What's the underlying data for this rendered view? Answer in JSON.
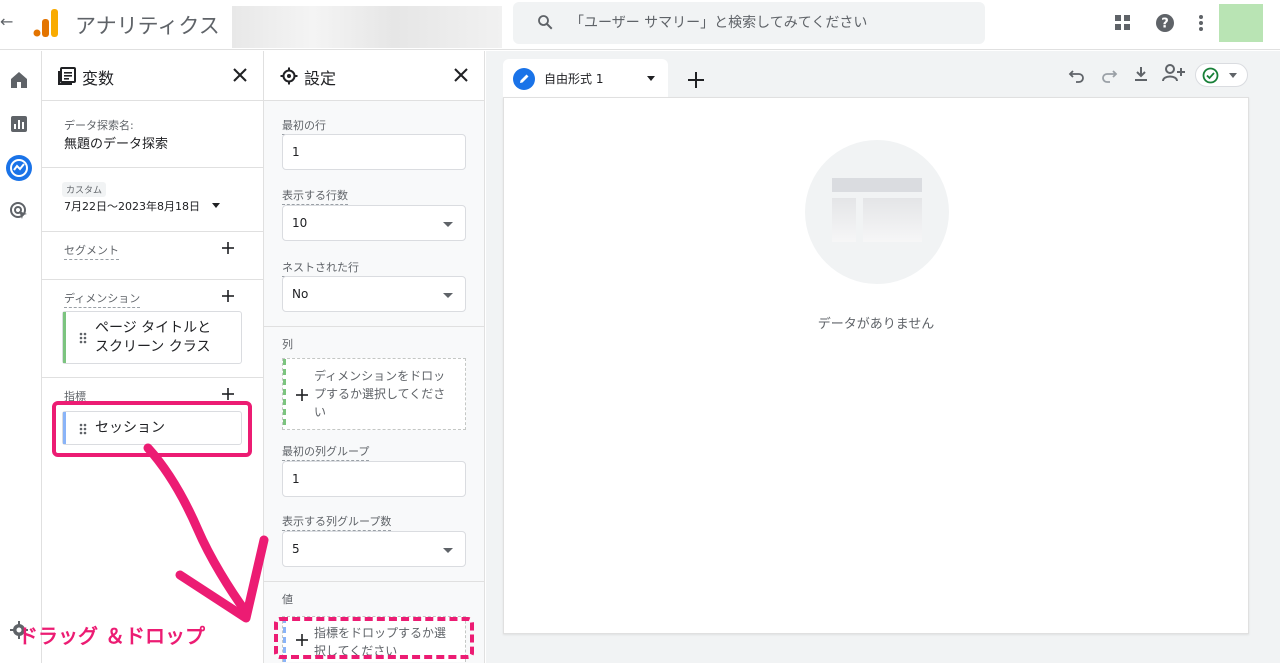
{
  "topbar": {
    "app_title": "アナリティクス",
    "search_placeholder": "「ユーザー サマリー」と検索してみてください"
  },
  "variables_panel": {
    "title": "変数",
    "exploration_name_label": "データ探索名:",
    "exploration_name": "無題のデータ探索",
    "date_badge": "カスタム",
    "date_range": "7月22日～2023年8月18日",
    "segment_label": "セグメント",
    "dimension_label": "ディメンション",
    "dimension_item_line1": "ページ タイトルと",
    "dimension_item_line2": "スクリーン クラス",
    "metric_label": "指標",
    "metric_item": "セッション"
  },
  "settings_panel": {
    "title": "設定",
    "first_row_label": "最初の行",
    "first_row_value": "1",
    "rows_label": "表示する行数",
    "rows_value": "10",
    "nested_label": "ネストされた行",
    "nested_value": "No",
    "columns_label": "列",
    "columns_drop_line1": "ディメンションをドロッ",
    "columns_drop_line2": "プするか選択してくださ",
    "columns_drop_line3": "い",
    "first_col_group_label": "最初の列グループ",
    "first_col_group_value": "1",
    "col_groups_label": "表示する列グループ数",
    "col_groups_value": "5",
    "values_label": "値",
    "values_drop_line1": "指標をドロップするか選",
    "values_drop_line2": "択してください"
  },
  "workspace": {
    "tab_label": "自由形式 1",
    "empty_text": "データがありません"
  },
  "annotation": {
    "caption": "ドラッグ ＆ドロップ",
    "color": "#ec1c73"
  },
  "colors": {
    "accent_blue": "#1a73e8",
    "dimension_green": "#7cc47f",
    "metric_blue": "#8ab4f8",
    "logo_orange": "#f9ab00"
  }
}
